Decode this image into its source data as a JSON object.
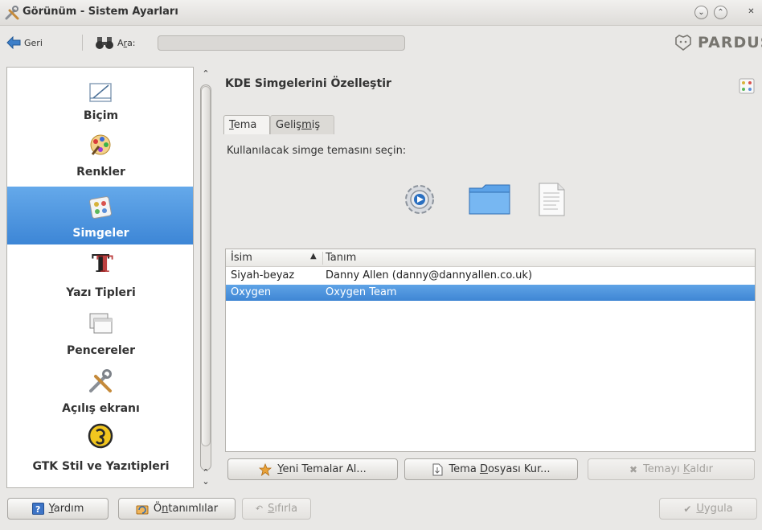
{
  "window": {
    "title": "Görünüm - Sistem Ayarları"
  },
  "toolbar": {
    "back_label": "Geri",
    "search_label": "Ara:",
    "search_value": "",
    "brand": "PARDUS"
  },
  "sidebar": {
    "items": [
      {
        "label": "Biçim",
        "icon": "format-icon",
        "selected": false
      },
      {
        "label": "Renkler",
        "icon": "colors-icon",
        "selected": false
      },
      {
        "label": "Simgeler",
        "icon": "icons-icon",
        "selected": true
      },
      {
        "label": "Yazı Tipleri",
        "icon": "fonts-icon",
        "selected": false
      },
      {
        "label": "Pencereler",
        "icon": "windows-icon",
        "selected": false
      },
      {
        "label": "Açılış ekranı",
        "icon": "splash-tools-icon",
        "selected": false
      },
      {
        "label": "GTK Stil ve Yazıtipleri",
        "icon": "gtk-icon",
        "selected": false
      }
    ]
  },
  "main": {
    "heading": "KDE Simgelerini Özelleştir",
    "tabs": [
      {
        "label": "Tema",
        "active": true
      },
      {
        "label": "Gelişmiş",
        "active": false
      }
    ],
    "instruction": "Kullanılacak simge temasını seçin:",
    "preview_icons": [
      "settings-gear-icon",
      "folder-icon",
      "document-icon"
    ],
    "table": {
      "columns": [
        "İsim",
        "Tanım"
      ],
      "sorted_column": "İsim",
      "rows": [
        {
          "name": "Siyah-beyaz",
          "description": "Danny Allen (danny@dannyallen.co.uk)",
          "selected": false
        },
        {
          "name": "Oxygen",
          "description": "Oxygen Team",
          "selected": true
        }
      ]
    },
    "buttons": {
      "new_themes": "Yeni Temalar Al...",
      "install_file": "Tema Dosyası Kur...",
      "remove_theme": "Temayı Kaldır"
    }
  },
  "bottom": {
    "help": "Yardım",
    "defaults": "Öntanımlılar",
    "reset": "Sıfırla",
    "apply": "Uygula"
  },
  "colors": {
    "selection": "#3f86d4",
    "window_bg": "#e9e8e6"
  }
}
